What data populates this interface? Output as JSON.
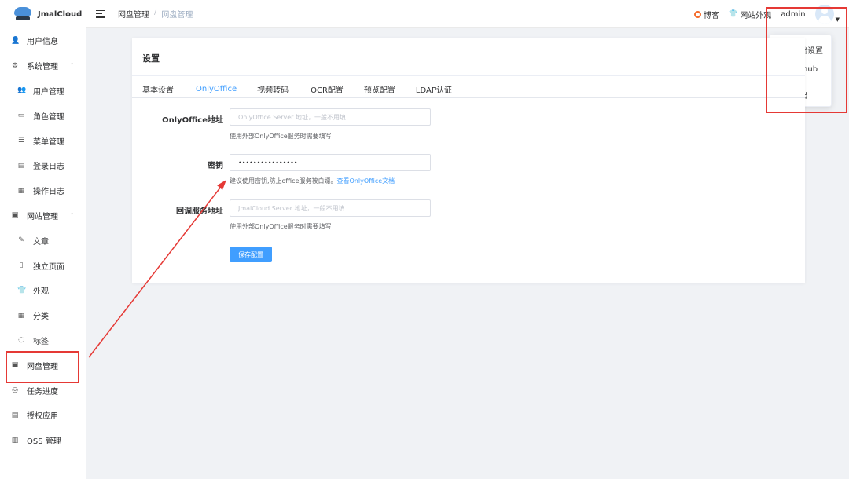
{
  "app": {
    "name": "JmalCloud"
  },
  "sidebar": {
    "items": [
      {
        "label": "用户信息",
        "icon": "person-icon",
        "glyph": "👤"
      },
      {
        "label": "系统管理",
        "icon": "gear-icon",
        "glyph": "⚙"
      },
      {
        "label": "用户管理",
        "icon": "users-icon",
        "glyph": "👥"
      },
      {
        "label": "角色管理",
        "icon": "id-card-icon",
        "glyph": "▭"
      },
      {
        "label": "菜单管理",
        "icon": "sliders-icon",
        "glyph": "☰"
      },
      {
        "label": "登录日志",
        "icon": "log-icon",
        "glyph": "▤"
      },
      {
        "label": "操作日志",
        "icon": "calendar-icon",
        "glyph": "▦"
      },
      {
        "label": "网站管理",
        "icon": "monitor-icon",
        "glyph": "▣"
      },
      {
        "label": "文章",
        "icon": "article-icon",
        "glyph": "✎"
      },
      {
        "label": "独立页面",
        "icon": "page-icon",
        "glyph": "▯"
      },
      {
        "label": "外观",
        "icon": "tshirt-icon",
        "glyph": "👕"
      },
      {
        "label": "分类",
        "icon": "category-icon",
        "glyph": "▦"
      },
      {
        "label": "标签",
        "icon": "tag-icon",
        "glyph": "◌"
      },
      {
        "label": "网盘管理",
        "icon": "netdisk-icon",
        "glyph": "▣"
      },
      {
        "label": "任务进度",
        "icon": "progress-icon",
        "glyph": "◎"
      },
      {
        "label": "授权应用",
        "icon": "app-icon",
        "glyph": "▤"
      },
      {
        "label": "OSS 管理",
        "icon": "database-icon",
        "glyph": "▥"
      }
    ]
  },
  "header": {
    "breadcrumb": [
      "网盘管理",
      "网盘管理"
    ],
    "blog_label": "博客",
    "appearance_label": "网站外观",
    "username": "admin"
  },
  "dropdown": {
    "items": [
      "基础设置",
      "github",
      "登出"
    ]
  },
  "settings": {
    "title": "设置",
    "tabs": [
      "基本设置",
      "OnlyOffice",
      "视频转码",
      "OCR配置",
      "预览配置",
      "LDAP认证"
    ],
    "active_tab": "OnlyOffice",
    "fields": {
      "server": {
        "label": "OnlyOffice地址",
        "placeholder": "OnlyOffice Server 地址，一般不用填",
        "hint": "使用外部OnlyOffice服务时需要填写"
      },
      "secret": {
        "label": "密钥",
        "value": "••••••••••••••••",
        "hint": "建议使用密钥,防止office服务被白嫖。",
        "hint_link": "查看OnlyOffice文档"
      },
      "callback": {
        "label": "回调服务地址",
        "placeholder": "JmalCloud Server 地址，一般不用填",
        "hint": "使用外部OnlyOffice服务时需要填写"
      }
    },
    "save_label": "保存配置"
  },
  "colors": {
    "accent": "#409eff",
    "annotation": "#e53935"
  }
}
